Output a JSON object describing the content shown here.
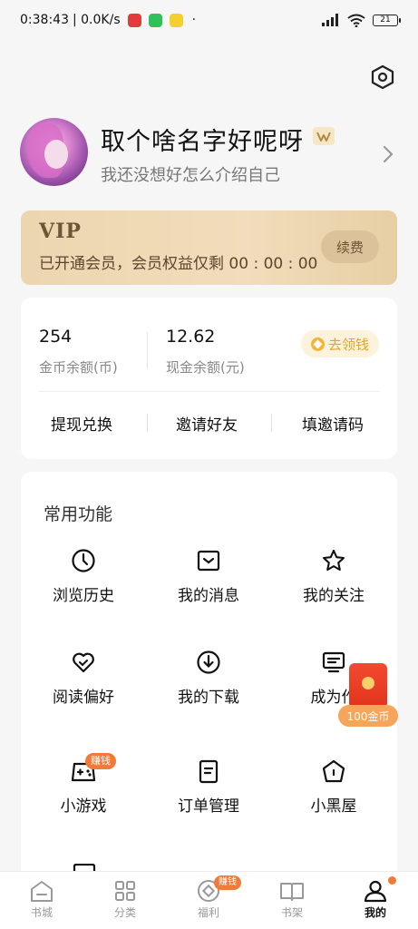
{
  "status_bar": {
    "time": "0:38:43",
    "net_speed": "| 0.0K/s",
    "battery": "21",
    "dot": "·"
  },
  "profile": {
    "username": "取个啥名字好呢呀",
    "bio": "我还没想好怎么介绍自己"
  },
  "vip": {
    "title": "VIP",
    "desc": "已开通会员，会员权益仅剩 00 : 00 : 00",
    "renew_label": "续费"
  },
  "balance": {
    "coin_value": "254",
    "coin_label": "金币余额(币)",
    "cash_value": "12.62",
    "cash_label": "现金余额(元)",
    "claim_label": "去领钱",
    "actions": [
      "提现兑换",
      "邀请好友",
      "填邀请码"
    ]
  },
  "functions": {
    "title": "常用功能",
    "items": [
      {
        "label": "浏览历史",
        "icon": "clock-icon"
      },
      {
        "label": "我的消息",
        "icon": "message-icon"
      },
      {
        "label": "我的关注",
        "icon": "star-icon"
      },
      {
        "label": "阅读偏好",
        "icon": "heart-icon"
      },
      {
        "label": "我的下载",
        "icon": "download-icon"
      },
      {
        "label": "成为作",
        "icon": "author-icon"
      },
      {
        "label": "小游戏",
        "icon": "gamepad-icon",
        "badge": "赚钱"
      },
      {
        "label": "订单管理",
        "icon": "order-icon"
      },
      {
        "label": "小黑屋",
        "icon": "house-icon"
      }
    ]
  },
  "floating_reward": {
    "label": "100金币"
  },
  "tab_bar": {
    "tabs": [
      {
        "label": "书城",
        "icon": "bookstore-icon"
      },
      {
        "label": "分类",
        "icon": "category-icon"
      },
      {
        "label": "福利",
        "icon": "welfare-icon",
        "badge": "赚钱"
      },
      {
        "label": "书架",
        "icon": "bookshelf-icon"
      },
      {
        "label": "我的",
        "icon": "profile-icon",
        "active": true
      }
    ]
  },
  "colors": {
    "accent": "#f07a3a",
    "vip_gold": "#e7cfa4",
    "claim_gold": "#e2a52a"
  }
}
